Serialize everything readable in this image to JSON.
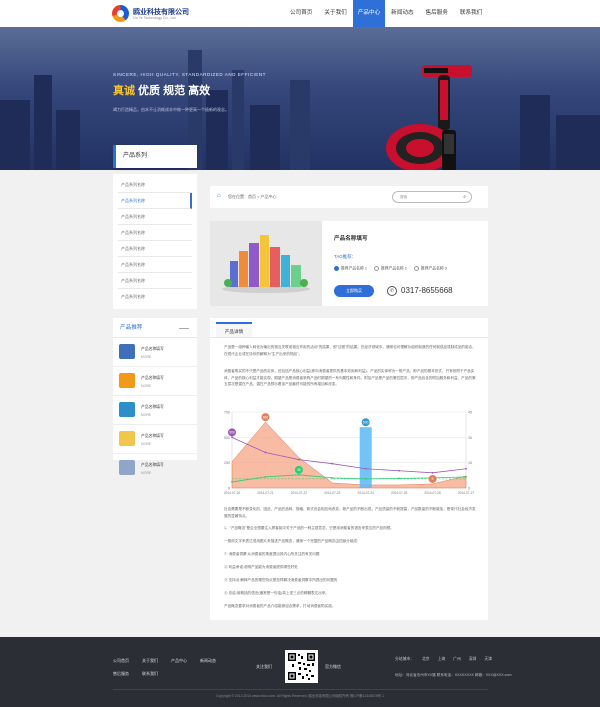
{
  "header": {
    "logo_cn": "鸥业科技有限公司",
    "logo_en": "Ou Ye Technology Co., Ltd.",
    "nav": [
      "公司首页",
      "关于我们",
      "产品中心",
      "新闻动态",
      "售后服务",
      "联系我们"
    ],
    "active_nav": "产品中心"
  },
  "banner": {
    "en": "SINCERE, HIGH QUALITY, STANDARDIZED AND EFFICIENT",
    "cn_first": "真诚",
    "cn_rest": " 优质 规范 高效",
    "sub": "竭力打造精品，由本不让消耗成本中做一种更高一个极新的观念。"
  },
  "sidebar": {
    "title": "产品系列",
    "items": [
      "产品系列名称",
      "产品系列名称",
      "产品系列名称",
      "产品系列名称",
      "产品系列名称",
      "产品系列名称",
      "产品系列名称",
      "产品系列名称"
    ],
    "active_index": 1
  },
  "recommend": {
    "title": "产品推荐",
    "items": [
      {
        "name": "产品名称填写",
        "sub": "MORE"
      },
      {
        "name": "产品名称填写",
        "sub": "MORE"
      },
      {
        "name": "产品名称填写",
        "sub": "MORE"
      },
      {
        "name": "产品名称填写",
        "sub": "MORE"
      },
      {
        "name": "产品名称填写",
        "sub": "MORE"
      }
    ]
  },
  "breadcrumb": {
    "text": "您在位置：首页 > 产品中心",
    "search_placeholder": "搜索"
  },
  "product": {
    "name": "产品名称填写",
    "tag_label": "TAG推荐：",
    "options": [
      "推荐产品名称 1",
      "推荐产品名称 2",
      "推荐产品名称 3"
    ],
    "active_option": 0,
    "button": "立即购买",
    "phone": "0317-8655668"
  },
  "detail": {
    "tab": "产品详情",
    "para1": "产品是一组种输入转化为输出的相互关联或相互作用的活动\"的结果，即\"过程\"的结果。在经济领域中，通常也可理解为组织制造的任何制成品或制成品的组合。在现代企业或在协你的解释为\"生产出来的物品\"。",
    "para2": "消费者购买的不只是产品的实体，还包括产品核心利益(即向消费者提供的基本效用和利益)。产品的实体称为一般产品，即产品的基本形式，只有依附于产品实体，产品的核心利益才能实现。期望产品是消费者采购产品时期望的一系列属性和条件。附加产品是产品的第四层次，即产品包含的附加服务和利益，产品的第五层次是潜在产品，潜在产品预示着该产品最终可能的所有增加和改变。",
    "para3": "社会需要是不断变化的，因此，产品的品种、规格、款式也会相应地改变。新产品的不断出现，产品质量的不断提高，产品数量的不断增加，是现代社会经济发展的显著特点。",
    "list": [
      "1、\"产品概念\"是企业想要注入顾客脑中关于产品的一种主观意念，它是用消费者的语言来表达的产品构想。",
      "一般用文字来表达或用图片来描述产品概念，通常一个完整的产品概念由四部分组成：",
      "① 消费者洞察:从消费者的角度提出其内心所关注的有关问题",
      "② 利益承诺:说明产品能为消费者提供哪些好处",
      "③ 支持点:解释产品的哪些特点是怎样解决消费者洞察中所提出的问题的",
      "④ 总结:用概括的语言(通常是一句话)将上述三点的精髓表达出来。",
      "产品概念要求对消费者的产品介绍能够迎合需求，打动消费者购买欲。"
    ]
  },
  "chart_data": {
    "type": "area",
    "categories": [
      "2014-07-20",
      "2014-07-21",
      "2014-07-22",
      "2014-07-23",
      "2014-07-24",
      "2014-07-25",
      "2014-07-26",
      "2014-07-27"
    ],
    "y_left_ticks": [
      "750",
      "500",
      "250",
      "0"
    ],
    "y_right_ticks": [
      "45",
      "30",
      "15",
      "0"
    ],
    "ylim_left": [
      0,
      750
    ],
    "ylim_right": [
      0,
      45
    ],
    "series": [
      {
        "kind": "area",
        "color": "#f3a07c",
        "values": [
          260,
          650,
          300,
          50,
          30,
          30,
          40,
          120
        ]
      },
      {
        "kind": "bar",
        "color": "#5bb8f5",
        "values": [
          0,
          0,
          0,
          0,
          600,
          0,
          0,
          0
        ]
      },
      {
        "kind": "line",
        "color": "#9b59b6",
        "values": [
          500,
          350,
          280,
          240,
          190,
          170,
          150,
          190
        ]
      },
      {
        "kind": "line",
        "color": "#2ecc71",
        "values": [
          60,
          110,
          130,
          100,
          90,
          95,
          100,
          110
        ]
      }
    ],
    "markers": [
      {
        "label": "650",
        "series": 0,
        "index": 1,
        "color": "#e67e5b"
      },
      {
        "label": "500",
        "series": 2,
        "index": 0,
        "color": "#9b59b6"
      },
      {
        "label": "600",
        "series": 1,
        "index": 4,
        "color": "#3498db"
      },
      {
        "label": "30",
        "series": 3,
        "index": 2,
        "color": "#2ecc71"
      },
      {
        "label": "5",
        "series": 0,
        "index": 6,
        "color": "#e67e5b"
      }
    ]
  },
  "footer": {
    "nav": [
      "公司首页",
      "关于我们",
      "产品中心",
      "新闻动态",
      "售后服务",
      "联系我们"
    ],
    "follow": "关注我们",
    "weixin": "官方微信",
    "city_label": "分站城市：",
    "cities": [
      "北京",
      "上海",
      "广州",
      "深圳",
      "天津"
    ],
    "address": "地址：河北省沧州市XX路 联系电话：XXXXXXXX 邮箱：XXX@XXX.com",
    "copyright": "Copyright © 2012-2014 www.ohuo.com. All Rights Reserved. 鸥业科技有限公司版权所有 冀ICP备12345678号-1"
  },
  "colors": {
    "accent": "#2f6fd8",
    "footer_bg": "#2c2e35",
    "banner_dark": "#223263",
    "highlight": "#f5c32c"
  }
}
